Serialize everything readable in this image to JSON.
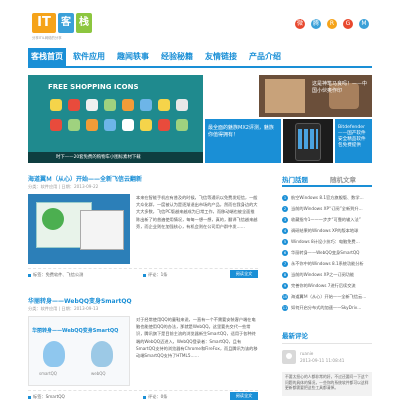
{
  "brand": {
    "logo_it": "IT",
    "logo_char1": "客",
    "logo_char2": "栈",
    "tagline": "分享ITIL网络的分享"
  },
  "social_icons": [
    {
      "name": "sina-weibo-icon",
      "color": "#e8482e",
      "glyph": "微"
    },
    {
      "name": "tencent-weibo-icon",
      "color": "#3aa0d8",
      "glyph": "腾"
    },
    {
      "name": "rss-icon",
      "color": "#f5a31a",
      "glyph": "R"
    },
    {
      "name": "gift-icon",
      "color": "#e8482e",
      "glyph": "G"
    },
    {
      "name": "mail-icon",
      "color": "#3aa0d8",
      "glyph": "M"
    }
  ],
  "nav": {
    "items": [
      "客栈首页",
      "软件应用",
      "趣闻轶事",
      "经验秘籍",
      "友情链接",
      "产品介绍"
    ],
    "active_index": 0
  },
  "slider": {
    "main_title": "FREE SHOPPING ICONS",
    "main_caption": "时下——20套免费的购物车小图标素材下载",
    "slide_top_right": "这是神笔马良吗！——中国小伙奥作印",
    "slide_mid": "最全面的魅族MX2评测，魅族你值得拥有！",
    "slide_right": "Bitdefender——国产软件安全精品软件包免费提供"
  },
  "posts": [
    {
      "title": "海道翼Ｍ（从心）开始——全新飞信云翻新",
      "meta": "分类：软件应用 | 日期：2013-09-22",
      "excerpt": "本来在智能手机应有普及的时候，飞信等通讯以免费发短信，一般大众化群，一度被认为是逐渐退出市场的产品，然而在我身边的大大大多数，飞信PC版越来越成为日常工作，而移动端也被全面推陈出新了的普遍使用情况，每每一想一想，真的，翻译飞信越来越旁，而企业则在加强核心，有机会则在公司用户群中发……",
      "tags": "标签：免费软件、飞信公测",
      "comments": "评论：1条",
      "more": "阅读全文"
    },
    {
      "title": "华丽转身——WebQQ变身SmartQQ",
      "meta": "分类：软件应用 | 日期：2013-09-13",
      "excerpt": "对于经常使用QQ的童鞋来说，一直有一个不需要安装客户端在电脑也能使用QQ的办法，那就是WebQQ。这里要先交代一些常识，腾讯旗下是目前主流的浏览器新生SmartQQ，适用于各种终端的WebQQ迈进入，WebQQ登录者：SmartQQ，且有SmartQQ支持的浏览器有Chrome和FireFox，而且腾讯为该的移动端SmartQQ支持了HTML5……",
      "tags": "标签：SmartQQ",
      "comments": "评论：0条",
      "more": "阅读全文",
      "thumb_title": "华丽转身——WebQQ变身SmartQQ",
      "thumb_label1": "smartQQ",
      "thumb_label2": "webQQ"
    }
  ],
  "sidebar": {
    "tab_hot": "热门話题",
    "tab_recent": "随机文章",
    "hot_items": [
      "航空Windows 8.1官方旗舰版、数学…",
      "当前的Windows XP“订阅”全新到升…",
      "收藏指令1——一步步“可靠的输入法”",
      "调研结果的Windows XP的版本地球",
      "Windows 8计设小技巧：电脑免费…",
      "华丽转身——WebQQ变身SmartQQ",
      "永不你中的Windows 8.1系统功能分析",
      "当前的Windows XP之一订阅功能",
      "完善你的Windows 7进行后续交流",
      "海道翼Ｍ（从心）开始——全新飞信云…",
      "如何开启分布式的加速——SkyDriv…"
    ],
    "recent_title": "最新评论",
    "comment": {
      "name": "ruanie",
      "date": "2013-09-11 11:08:41",
      "text": "不要太担心的人都非常的好，不过还要问一下这个问题的具体的情况，一些你的系统软件都可以这样更新都需要把这些工具都清掉。"
    }
  }
}
